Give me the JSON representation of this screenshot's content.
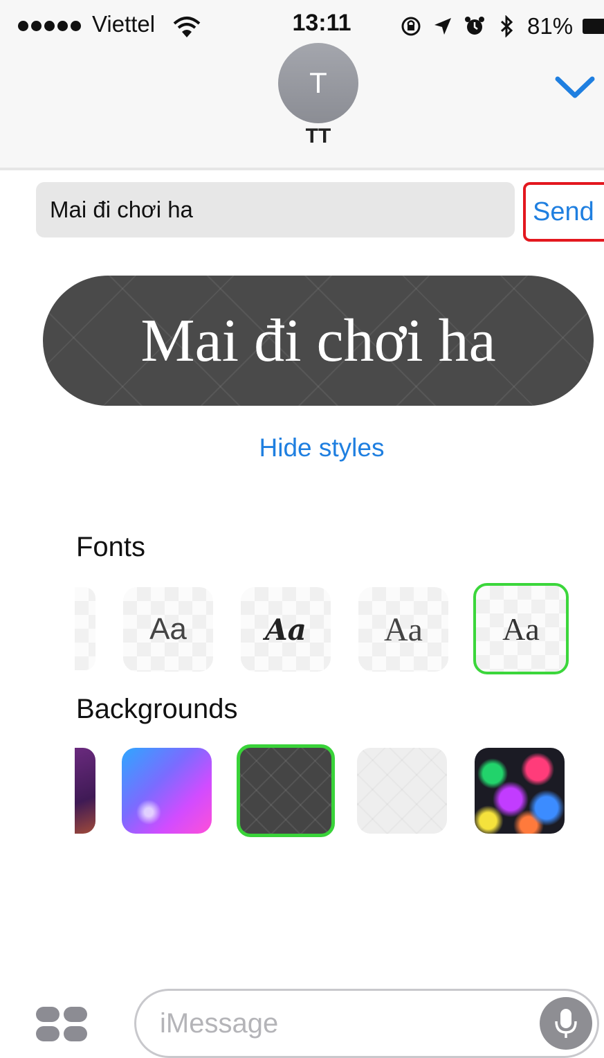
{
  "status_bar": {
    "carrier": "Viettel",
    "time": "13:11",
    "battery": "81%"
  },
  "header": {
    "avatar_initial": "T",
    "contact_name": "TT"
  },
  "compose": {
    "text": "Mai đi chơi ha",
    "send_label": "Send"
  },
  "preview": {
    "text": "Mai đi chơi ha"
  },
  "hide_styles_label": "Hide styles",
  "fonts": {
    "title": "Fonts",
    "options": [
      "Aa",
      "Aa",
      "Aa",
      "Aa"
    ],
    "selected_index": 3
  },
  "backgrounds": {
    "title": "Backgrounds",
    "options": [
      "purple-nebula",
      "blue-pink-galaxy",
      "dark-skull-pattern",
      "light-pattern",
      "rainbow-bokeh"
    ],
    "selected_index": 2
  },
  "input_bar": {
    "placeholder": "iMessage"
  },
  "colors": {
    "accent_blue": "#1f7fe0",
    "send_highlight": "#e3181f",
    "selection_green": "#3bd63b",
    "bubble_dark": "#4a4a4a"
  }
}
